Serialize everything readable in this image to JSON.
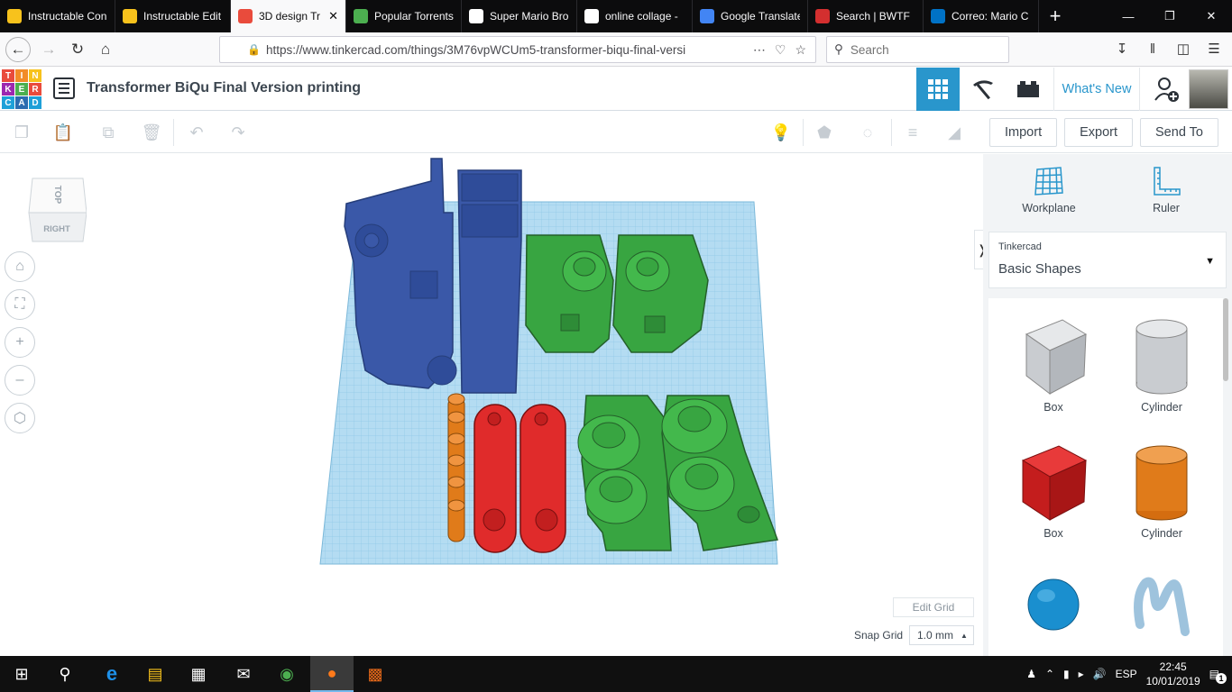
{
  "browser": {
    "tabs": [
      {
        "label": "Instructable Con",
        "color": "#f7c21c"
      },
      {
        "label": "Instructable Edit",
        "color": "#f7c21c"
      },
      {
        "label": "3D design Tr",
        "color": "#e94b3c",
        "active": true
      },
      {
        "label": "Popular Torrents",
        "color": "#4caf50"
      },
      {
        "label": "Super Mario Bro",
        "color": "#ffffff"
      },
      {
        "label": "online collage -",
        "color": "#ffffff"
      },
      {
        "label": "Google Translate",
        "color": "#4285f4"
      },
      {
        "label": "Search | BWTF",
        "color": "#d32f2f"
      },
      {
        "label": "Correo: Mario C",
        "color": "#0072c6"
      }
    ],
    "new_tab": "+",
    "url": "https://www.tinkercad.com/things/3M76vpWCUm5-transformer-biqu-final-versi",
    "search_placeholder": "Search"
  },
  "tinkercad": {
    "logo_letters": [
      "T",
      "I",
      "N",
      "K",
      "E",
      "R",
      "C",
      "A",
      "D"
    ],
    "logo_colors": [
      "#e94b3c",
      "#f28c28",
      "#f7c21c",
      "#9c27b0",
      "#4caf50",
      "#e94b3c",
      "#1ea0d8",
      "#2b6cb0",
      "#1ea0d8"
    ],
    "project_title": "Transformer BiQu Final Version printing",
    "whats_new": "What's New",
    "import": "Import",
    "export": "Export",
    "send_to": "Send To"
  },
  "viewport": {
    "viewcube_top": "TOP",
    "viewcube_right": "RIGHT",
    "edit_grid": "Edit Grid",
    "snap_grid_label": "Snap Grid",
    "snap_grid_value": "1.0 mm"
  },
  "sidebar": {
    "workplane": "Workplane",
    "ruler": "Ruler",
    "library_small": "Tinkercad",
    "library_big": "Basic Shapes",
    "shapes": [
      "Box",
      "Cylinder",
      "Box",
      "Cylinder"
    ]
  },
  "taskbar": {
    "lang": "ESP",
    "time": "22:45",
    "date": "10/01/2019",
    "notif_count": "1"
  }
}
